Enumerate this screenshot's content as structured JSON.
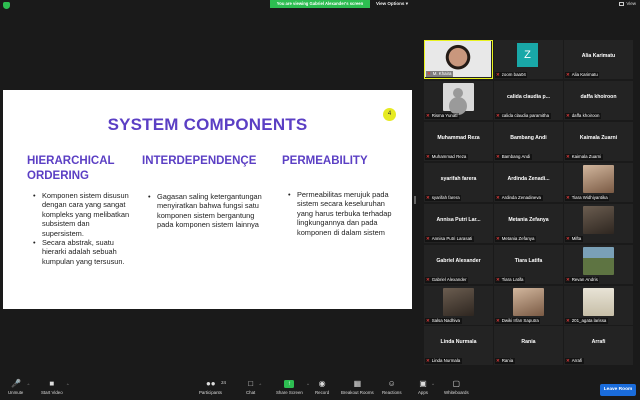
{
  "topbar": {
    "viewing_banner": "You are viewing Gabriel Alexander's screen",
    "view_options": "View Options",
    "view_label": "View"
  },
  "slide": {
    "title": "SYSTEM COMPONENTS",
    "page_badge": "4",
    "columns": [
      {
        "heading_line1": "HIERARCHICAL",
        "heading_line2": "ORDERING",
        "bullets": [
          "Komponen sistem disusun dengan cara yang sangat kompleks yang melibatkan subsistem dan supersistem.",
          "Secara abstrak, suatu hierarki adalah sebuah kumpulan yang tersusun."
        ]
      },
      {
        "heading_line1": "INTERDEPENDENÇE",
        "bullets": [
          "Gagasan saling ketergantungan menyiratkan bahwa fungsi satu komponen sistem bergantung pada komponen sistem lainnya"
        ]
      },
      {
        "heading_line1": "PERMEABILITY",
        "bullets": [
          "Permeabilitas merujuk pada sistem secara keseluruhan yang harus terbuka terhadap lingkungannya dan pada komponen di dalam sistem"
        ]
      }
    ]
  },
  "participants": [
    {
      "big": "",
      "name": "M. Khaira",
      "kind": "camera-main"
    },
    {
      "big": "",
      "name": "zoom baa04",
      "kind": "avatar-z",
      "avatar_letter": "Z"
    },
    {
      "big": "Alia Karimatu",
      "name": "Alia Karimatu",
      "kind": "name"
    },
    {
      "big": "",
      "name": "Risma Yunati",
      "kind": "placeholder"
    },
    {
      "big": "calida claudia p...",
      "name": "calida claudia paramitha",
      "kind": "name"
    },
    {
      "big": "daffa khoiroon",
      "name": "daffa khoiroon",
      "kind": "name"
    },
    {
      "big": "Muhammad Reza",
      "name": "Muhammad Reza",
      "kind": "name"
    },
    {
      "big": "Bambang Andi",
      "name": "Bambang Andi",
      "kind": "name"
    },
    {
      "big": "Kaimala Zuarni",
      "name": "Kaimala Zuarni",
      "kind": "name"
    },
    {
      "big": "syarifah farera",
      "name": "syarifah farera",
      "kind": "name"
    },
    {
      "big": "Ardinda Zenadi...",
      "name": "Ardinda Zenadineva",
      "kind": "name"
    },
    {
      "big": "",
      "name": "Tiara Widhiyantika",
      "kind": "warm"
    },
    {
      "big": "Annisa Putri Lar...",
      "name": "Annisa Putri Larasati",
      "kind": "name"
    },
    {
      "big": "Metania Zefanya",
      "name": "Metania Zefanya",
      "kind": "name"
    },
    {
      "big": "",
      "name": "Mifta",
      "kind": "dark"
    },
    {
      "big": "Gabriel Alexander",
      "name": "Gabriel Alexander",
      "kind": "name"
    },
    {
      "big": "Tiara Latifa",
      "name": "Tiara Latifa",
      "kind": "name"
    },
    {
      "big": "",
      "name": "Revan Andris",
      "kind": "land"
    },
    {
      "big": "",
      "name": "Salsa Nadhiva",
      "kind": "dark"
    },
    {
      "big": "",
      "name": "Dwiki Irfan Saputra",
      "kind": "warm"
    },
    {
      "big": "",
      "name": "201_agata larissa",
      "kind": "light"
    },
    {
      "big": "Linda Nurmala",
      "name": "Linda Nurmala",
      "kind": "name"
    },
    {
      "big": "Rania",
      "name": "Rania",
      "kind": "name"
    },
    {
      "big": "Arrafi",
      "name": "Arrafi",
      "kind": "name"
    }
  ],
  "toolbar": {
    "unmute": "Unmute",
    "start_video": "Start Video",
    "participants": "Participants",
    "participants_count": "24",
    "chat": "Chat",
    "share_screen": "Share Screen",
    "record": "Record",
    "breakout_rooms": "Breakout Rooms",
    "reactions": "Reactions",
    "apps": "Apps",
    "whiteboards": "Whiteboards",
    "leave_room": "Leave Room"
  },
  "colors": {
    "accent_purple": "#5b3fc4",
    "zoom_green": "#2dbd51",
    "leave_blue": "#1a6cdb",
    "muted_red": "#e23b3b",
    "active_speaker": "#e8f21e"
  }
}
